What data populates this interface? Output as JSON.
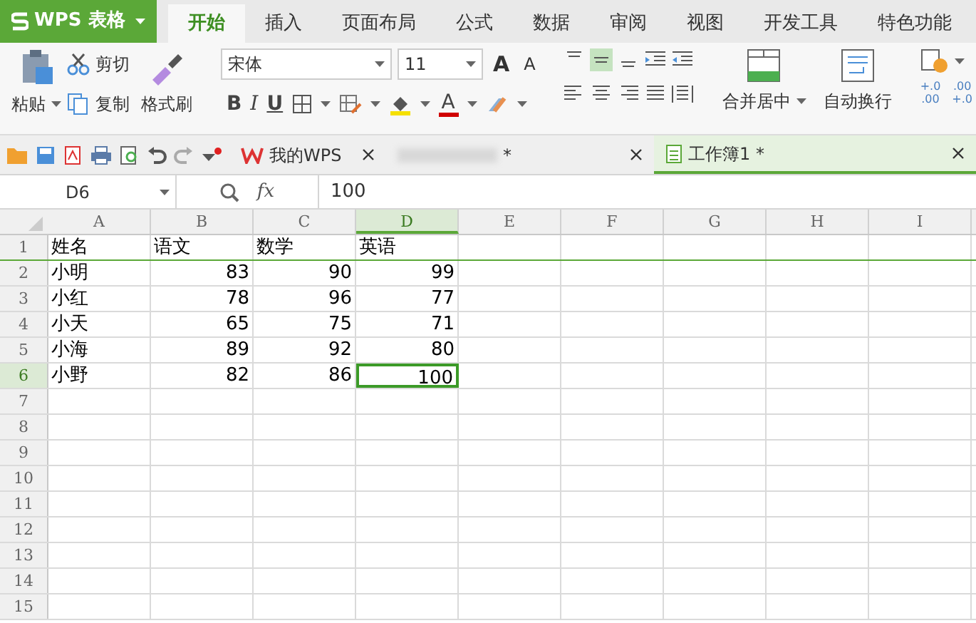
{
  "app_menu": {
    "label": "WPS 表格"
  },
  "ribbon_tabs": [
    {
      "label": "开始",
      "selected": true
    },
    {
      "label": "插入",
      "selected": false
    },
    {
      "label": "页面布局",
      "selected": false
    },
    {
      "label": "公式",
      "selected": false
    },
    {
      "label": "数据",
      "selected": false
    },
    {
      "label": "审阅",
      "selected": false
    },
    {
      "label": "视图",
      "selected": false
    },
    {
      "label": "开发工具",
      "selected": false
    },
    {
      "label": "特色功能",
      "selected": false
    }
  ],
  "clipboard": {
    "paste": "粘贴",
    "cut": "剪切",
    "copy": "复制",
    "format_painter": "格式刷"
  },
  "font": {
    "name": "宋体",
    "size": "11",
    "grow": "A",
    "shrink": "A",
    "bold": "B",
    "italic": "I",
    "underline": "U",
    "font_color": "A"
  },
  "alignment": {
    "center_selected": true,
    "merge": "合并居中",
    "wrap": "自动换行"
  },
  "number_format": {
    "increase_decimal": "+.0\n.00",
    "decrease_decimal": ".00\n+.0"
  },
  "doc_tabs": [
    {
      "label": "我的WPS",
      "kind": "home",
      "selected": false
    },
    {
      "label": "*",
      "kind": "redacted",
      "selected": false
    },
    {
      "label": "工作簿1 *",
      "kind": "sheet",
      "selected": true
    }
  ],
  "formula_bar": {
    "name_box": "D6",
    "fx": "fx",
    "value": "100"
  },
  "sheet": {
    "columns": [
      {
        "label": "A",
        "selected": false
      },
      {
        "label": "B",
        "selected": false
      },
      {
        "label": "C",
        "selected": false
      },
      {
        "label": "D",
        "selected": true
      },
      {
        "label": "E",
        "selected": false
      },
      {
        "label": "F",
        "selected": false
      },
      {
        "label": "G",
        "selected": false
      },
      {
        "label": "H",
        "selected": false
      },
      {
        "label": "I",
        "selected": false
      }
    ],
    "rows": [
      {
        "label": "1",
        "selected": false,
        "cells": [
          {
            "text": "姓名",
            "kind": "text",
            "selected": false
          },
          {
            "text": "语文",
            "kind": "text",
            "selected": false
          },
          {
            "text": "数学",
            "kind": "text",
            "selected": false
          },
          {
            "text": "英语",
            "kind": "text",
            "selected": false
          }
        ]
      },
      {
        "label": "2",
        "selected": false,
        "cells": [
          {
            "text": "小明",
            "kind": "text",
            "selected": false
          },
          {
            "text": "83",
            "kind": "number",
            "selected": false
          },
          {
            "text": "90",
            "kind": "number",
            "selected": false
          },
          {
            "text": "99",
            "kind": "number",
            "selected": false
          }
        ]
      },
      {
        "label": "3",
        "selected": false,
        "cells": [
          {
            "text": "小红",
            "kind": "text",
            "selected": false
          },
          {
            "text": "78",
            "kind": "number",
            "selected": false
          },
          {
            "text": "96",
            "kind": "number",
            "selected": false
          },
          {
            "text": "77",
            "kind": "number",
            "selected": false
          }
        ]
      },
      {
        "label": "4",
        "selected": false,
        "cells": [
          {
            "text": "小天",
            "kind": "text",
            "selected": false
          },
          {
            "text": "65",
            "kind": "number",
            "selected": false
          },
          {
            "text": "75",
            "kind": "number",
            "selected": false
          },
          {
            "text": "71",
            "kind": "number",
            "selected": false
          }
        ]
      },
      {
        "label": "5",
        "selected": false,
        "cells": [
          {
            "text": "小海",
            "kind": "text",
            "selected": false
          },
          {
            "text": "89",
            "kind": "number",
            "selected": false
          },
          {
            "text": "92",
            "kind": "number",
            "selected": false
          },
          {
            "text": "80",
            "kind": "number",
            "selected": false
          }
        ]
      },
      {
        "label": "6",
        "selected": true,
        "cells": [
          {
            "text": "小野",
            "kind": "text",
            "selected": false
          },
          {
            "text": "82",
            "kind": "number",
            "selected": false
          },
          {
            "text": "86",
            "kind": "number",
            "selected": false
          },
          {
            "text": "100",
            "kind": "number",
            "selected": true
          }
        ]
      },
      {
        "label": "7",
        "selected": false
      },
      {
        "label": "8",
        "selected": false
      },
      {
        "label": "9",
        "selected": false
      },
      {
        "label": "10",
        "selected": false
      },
      {
        "label": "11",
        "selected": false
      },
      {
        "label": "12",
        "selected": false
      },
      {
        "label": "13",
        "selected": false
      },
      {
        "label": "14",
        "selected": false
      },
      {
        "label": "15",
        "selected": false
      }
    ]
  }
}
